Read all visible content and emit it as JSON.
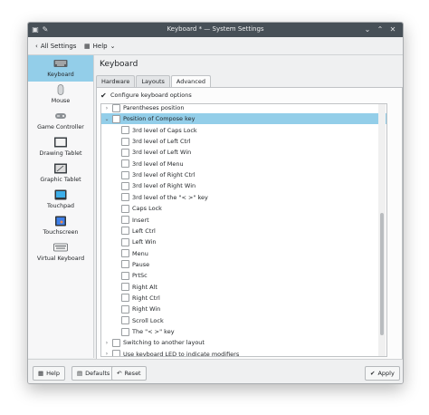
{
  "window": {
    "title": "Keyboard * — System Settings"
  },
  "toolbar": {
    "back_label": "All Settings",
    "help_label": "Help"
  },
  "sidebar": {
    "items": [
      {
        "label": "Keyboard",
        "icon": "keyboard-icon",
        "active": true
      },
      {
        "label": "Mouse",
        "icon": "mouse-icon"
      },
      {
        "label": "Game Controller",
        "icon": "game-controller-icon"
      },
      {
        "label": "Drawing Tablet",
        "icon": "drawing-tablet-icon"
      },
      {
        "label": "Graphic Tablet",
        "icon": "graphic-tablet-icon"
      },
      {
        "label": "Touchpad",
        "icon": "touchpad-icon"
      },
      {
        "label": "Touchscreen",
        "icon": "touchscreen-icon"
      },
      {
        "label": "Virtual Keyboard",
        "icon": "virtual-keyboard-icon"
      }
    ]
  },
  "main": {
    "title": "Keyboard",
    "tabs": [
      {
        "label": "Hardware"
      },
      {
        "label": "Layouts"
      },
      {
        "label": "Advanced",
        "active": true
      }
    ],
    "configure_label": "Configure keyboard options",
    "tree": [
      {
        "label": "Parentheses position",
        "level": 0,
        "expanded": false
      },
      {
        "label": "Position of Compose key",
        "level": 0,
        "expanded": true,
        "selected": true
      },
      {
        "label": "3rd level of Caps Lock",
        "level": 1
      },
      {
        "label": "3rd level of Left Ctrl",
        "level": 1
      },
      {
        "label": "3rd level of Left Win",
        "level": 1
      },
      {
        "label": "3rd level of Menu",
        "level": 1
      },
      {
        "label": "3rd level of Right Ctrl",
        "level": 1
      },
      {
        "label": "3rd level of Right Win",
        "level": 1
      },
      {
        "label": "3rd level of the \"< >\" key",
        "level": 1
      },
      {
        "label": "Caps Lock",
        "level": 1
      },
      {
        "label": "Insert",
        "level": 1
      },
      {
        "label": "Left Ctrl",
        "level": 1
      },
      {
        "label": "Left Win",
        "level": 1
      },
      {
        "label": "Menu",
        "level": 1
      },
      {
        "label": "Pause",
        "level": 1
      },
      {
        "label": "PrtSc",
        "level": 1
      },
      {
        "label": "Right Alt",
        "level": 1
      },
      {
        "label": "Right Ctrl",
        "level": 1
      },
      {
        "label": "Right Win",
        "level": 1
      },
      {
        "label": "Scroll Lock",
        "level": 1
      },
      {
        "label": "The \"< >\" key",
        "level": 1
      },
      {
        "label": "Switching to another layout",
        "level": 0,
        "expanded": false
      },
      {
        "label": "Use keyboard LED to indicate modifiers",
        "level": 0,
        "expanded": false
      }
    ]
  },
  "buttons": {
    "help": "Help",
    "defaults": "Defaults",
    "reset": "Reset",
    "apply": "Apply"
  },
  "colors": {
    "accent": "#93cee9",
    "titlebar": "#475057",
    "window": "#eff0f1"
  }
}
